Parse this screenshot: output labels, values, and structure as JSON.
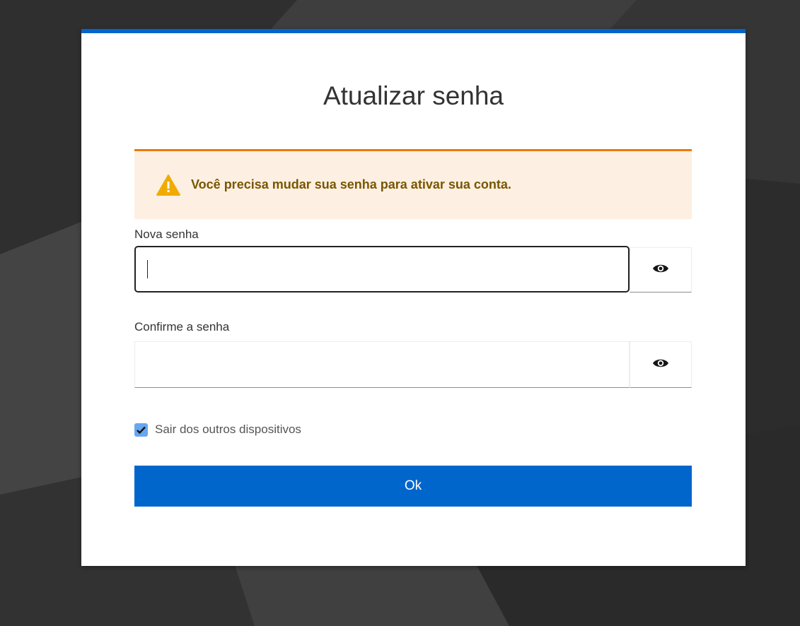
{
  "colors": {
    "accent": "#0066cc",
    "warning_border": "#ec7a08",
    "warning_bg": "#fdf0e2",
    "warning_text": "#795600",
    "backdrop": "#3a3a3a"
  },
  "dialog": {
    "title": "Atualizar senha"
  },
  "alert": {
    "icon": "warning-triangle-icon",
    "message": "Você precisa mudar sua senha para ativar sua conta."
  },
  "fields": {
    "new_password": {
      "label": "Nova senha",
      "value": "",
      "toggle_icon": "eye-icon"
    },
    "confirm_password": {
      "label": "Confirme a senha",
      "value": "",
      "toggle_icon": "eye-icon"
    }
  },
  "logout_other_devices": {
    "label": "Sair dos outros dispositivos",
    "checked": true
  },
  "submit": {
    "label": "Ok"
  }
}
